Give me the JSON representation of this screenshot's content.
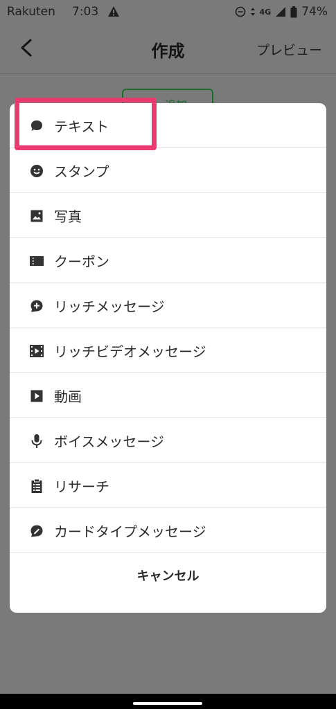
{
  "status_bar": {
    "carrier": "Rakuten",
    "time": "7:03",
    "network": "4G",
    "battery": "74%"
  },
  "app_bar": {
    "title": "作成",
    "preview_label": "プレビュー"
  },
  "background": {
    "chip_label": "追加"
  },
  "menu": {
    "items": [
      {
        "label": "テキスト",
        "icon": "speech-bubble-icon"
      },
      {
        "label": "スタンプ",
        "icon": "smiley-icon"
      },
      {
        "label": "写真",
        "icon": "image-icon"
      },
      {
        "label": "クーポン",
        "icon": "coupon-icon"
      },
      {
        "label": "リッチメッセージ",
        "icon": "rich-message-icon"
      },
      {
        "label": "リッチビデオメッセージ",
        "icon": "rich-video-icon"
      },
      {
        "label": "動画",
        "icon": "video-play-icon"
      },
      {
        "label": "ボイスメッセージ",
        "icon": "microphone-icon"
      },
      {
        "label": "リサーチ",
        "icon": "clipboard-icon"
      },
      {
        "label": "カードタイプメッセージ",
        "icon": "card-message-icon"
      }
    ],
    "cancel_label": "キャンセル"
  },
  "colors": {
    "highlight": "#ea3a6f",
    "overlay": "#7a7a7a",
    "accent_green": "#1f6b2e"
  }
}
